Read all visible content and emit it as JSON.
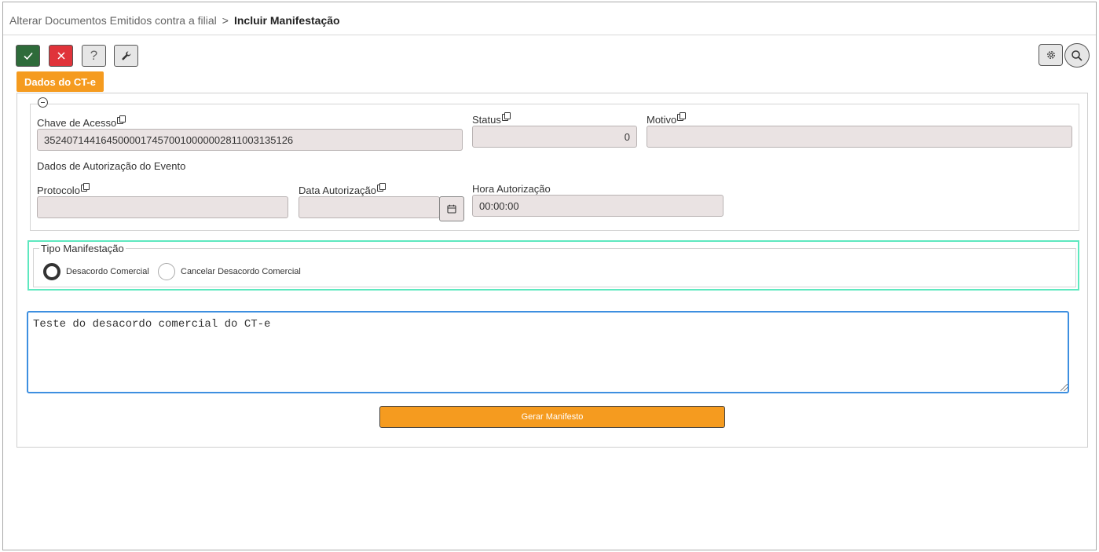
{
  "breadcrumb": {
    "parent": "Alterar Documentos Emitidos contra a filial",
    "separator": ">",
    "current": "Incluir Manifestação"
  },
  "toolbar": {
    "confirm_icon": "check-icon",
    "cancel_icon": "close-icon",
    "help_label": "?",
    "tools_icon": "wrench-icon",
    "settings_icon": "gear-icon",
    "search_icon": "search-icon"
  },
  "tab": {
    "label": "Dados do CT-e"
  },
  "fields": {
    "chave_label": "Chave de Acesso",
    "chave_value": "35240714416450000174570010000002811003135126",
    "status_label": "Status",
    "status_value": "0",
    "motivo_label": "Motivo",
    "motivo_value": "",
    "section_label": "Dados de Autorização do Evento",
    "protocolo_label": "Protocolo",
    "protocolo_value": "",
    "data_label": "Data Autorização",
    "data_value": "",
    "hora_label": "Hora Autorização",
    "hora_value": "00:00:00"
  },
  "tipo": {
    "legend": "Tipo Manifestação",
    "options": [
      {
        "label": "Desacordo Comercial",
        "selected": true
      },
      {
        "label": "Cancelar Desacordo Comercial",
        "selected": false
      }
    ]
  },
  "observacao": {
    "value": "Teste do desacordo comercial do CT-e"
  },
  "generate_button": {
    "label": "Gerar Manifesto"
  },
  "colors": {
    "accent": "#f59b1f",
    "confirm": "#2e6b3a",
    "cancel": "#e0333a",
    "focus": "#3d8fe0",
    "highlight": "#5ee8bf"
  }
}
